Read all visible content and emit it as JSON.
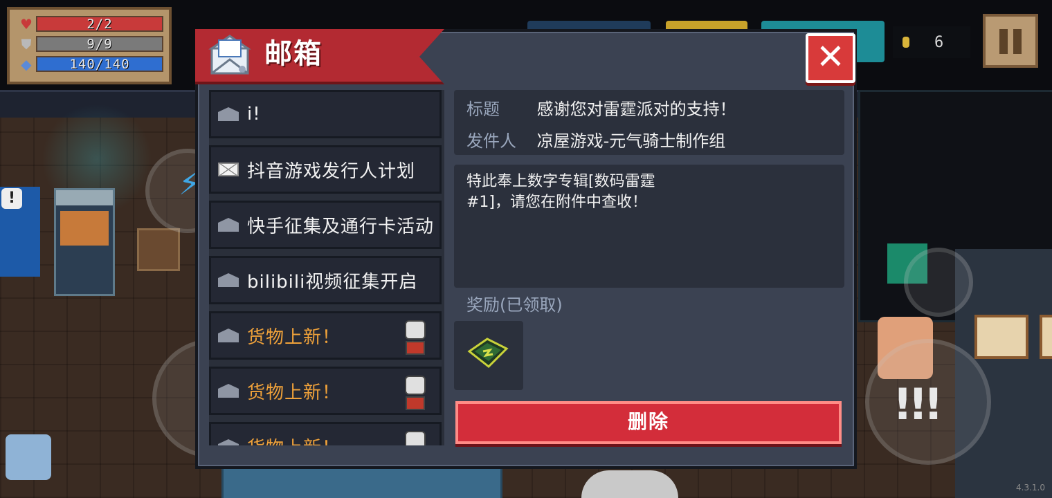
{
  "hud": {
    "hp": "2/2",
    "hp_fraction": 1.0,
    "armor": "9/9",
    "armor_fraction": 1.0,
    "energy": "140/140",
    "energy_fraction": 1.0,
    "gems": "6",
    "version": "4.3.1.0",
    "colors": {
      "hp": "#c83a3a",
      "armor": "#7a7a7a",
      "energy": "#2f6ed0"
    },
    "icons": [
      "heart-icon",
      "shield-icon",
      "diamond-icon",
      "gem-icon",
      "pause-icon"
    ]
  },
  "mailbox": {
    "title": "邮箱",
    "close_icon": "close-icon",
    "items": [
      {
        "title": "i!",
        "icon": "envelope-open-icon",
        "highlight": false,
        "has_npc": false
      },
      {
        "title": "抖音游戏发行人计划",
        "icon": "envelope-closed-icon",
        "highlight": false,
        "has_npc": false
      },
      {
        "title": "快手征集及通行卡活动",
        "icon": "envelope-open-icon",
        "highlight": false,
        "has_npc": false
      },
      {
        "title": "bilibili视频征集开启",
        "icon": "envelope-open-icon",
        "highlight": false,
        "has_npc": false
      },
      {
        "title": "货物上新！",
        "icon": "envelope-open-icon",
        "highlight": true,
        "has_npc": true
      },
      {
        "title": "货物上新！",
        "icon": "envelope-open-icon",
        "highlight": true,
        "has_npc": true
      },
      {
        "title": "货物上新！",
        "icon": "envelope-open-icon",
        "highlight": true,
        "has_npc": true
      }
    ],
    "detail": {
      "subject_label": "标题",
      "subject": "感谢您对雷霆派对的支持！",
      "sender_label": "发件人",
      "sender": "凉屋游戏-元气骑士制作组",
      "body": "特此奉上数字专辑[数码雷霆\n#1]，请您在附件中查收！",
      "reward_label": "奖励(已领取)",
      "reward_icon": "digital-album-icon",
      "delete_label": "删除"
    },
    "colors": {
      "banner": "#b32a32",
      "close": "#d83a3a",
      "delete": "#d32d3a",
      "highlight_text": "#f0a23a"
    }
  }
}
